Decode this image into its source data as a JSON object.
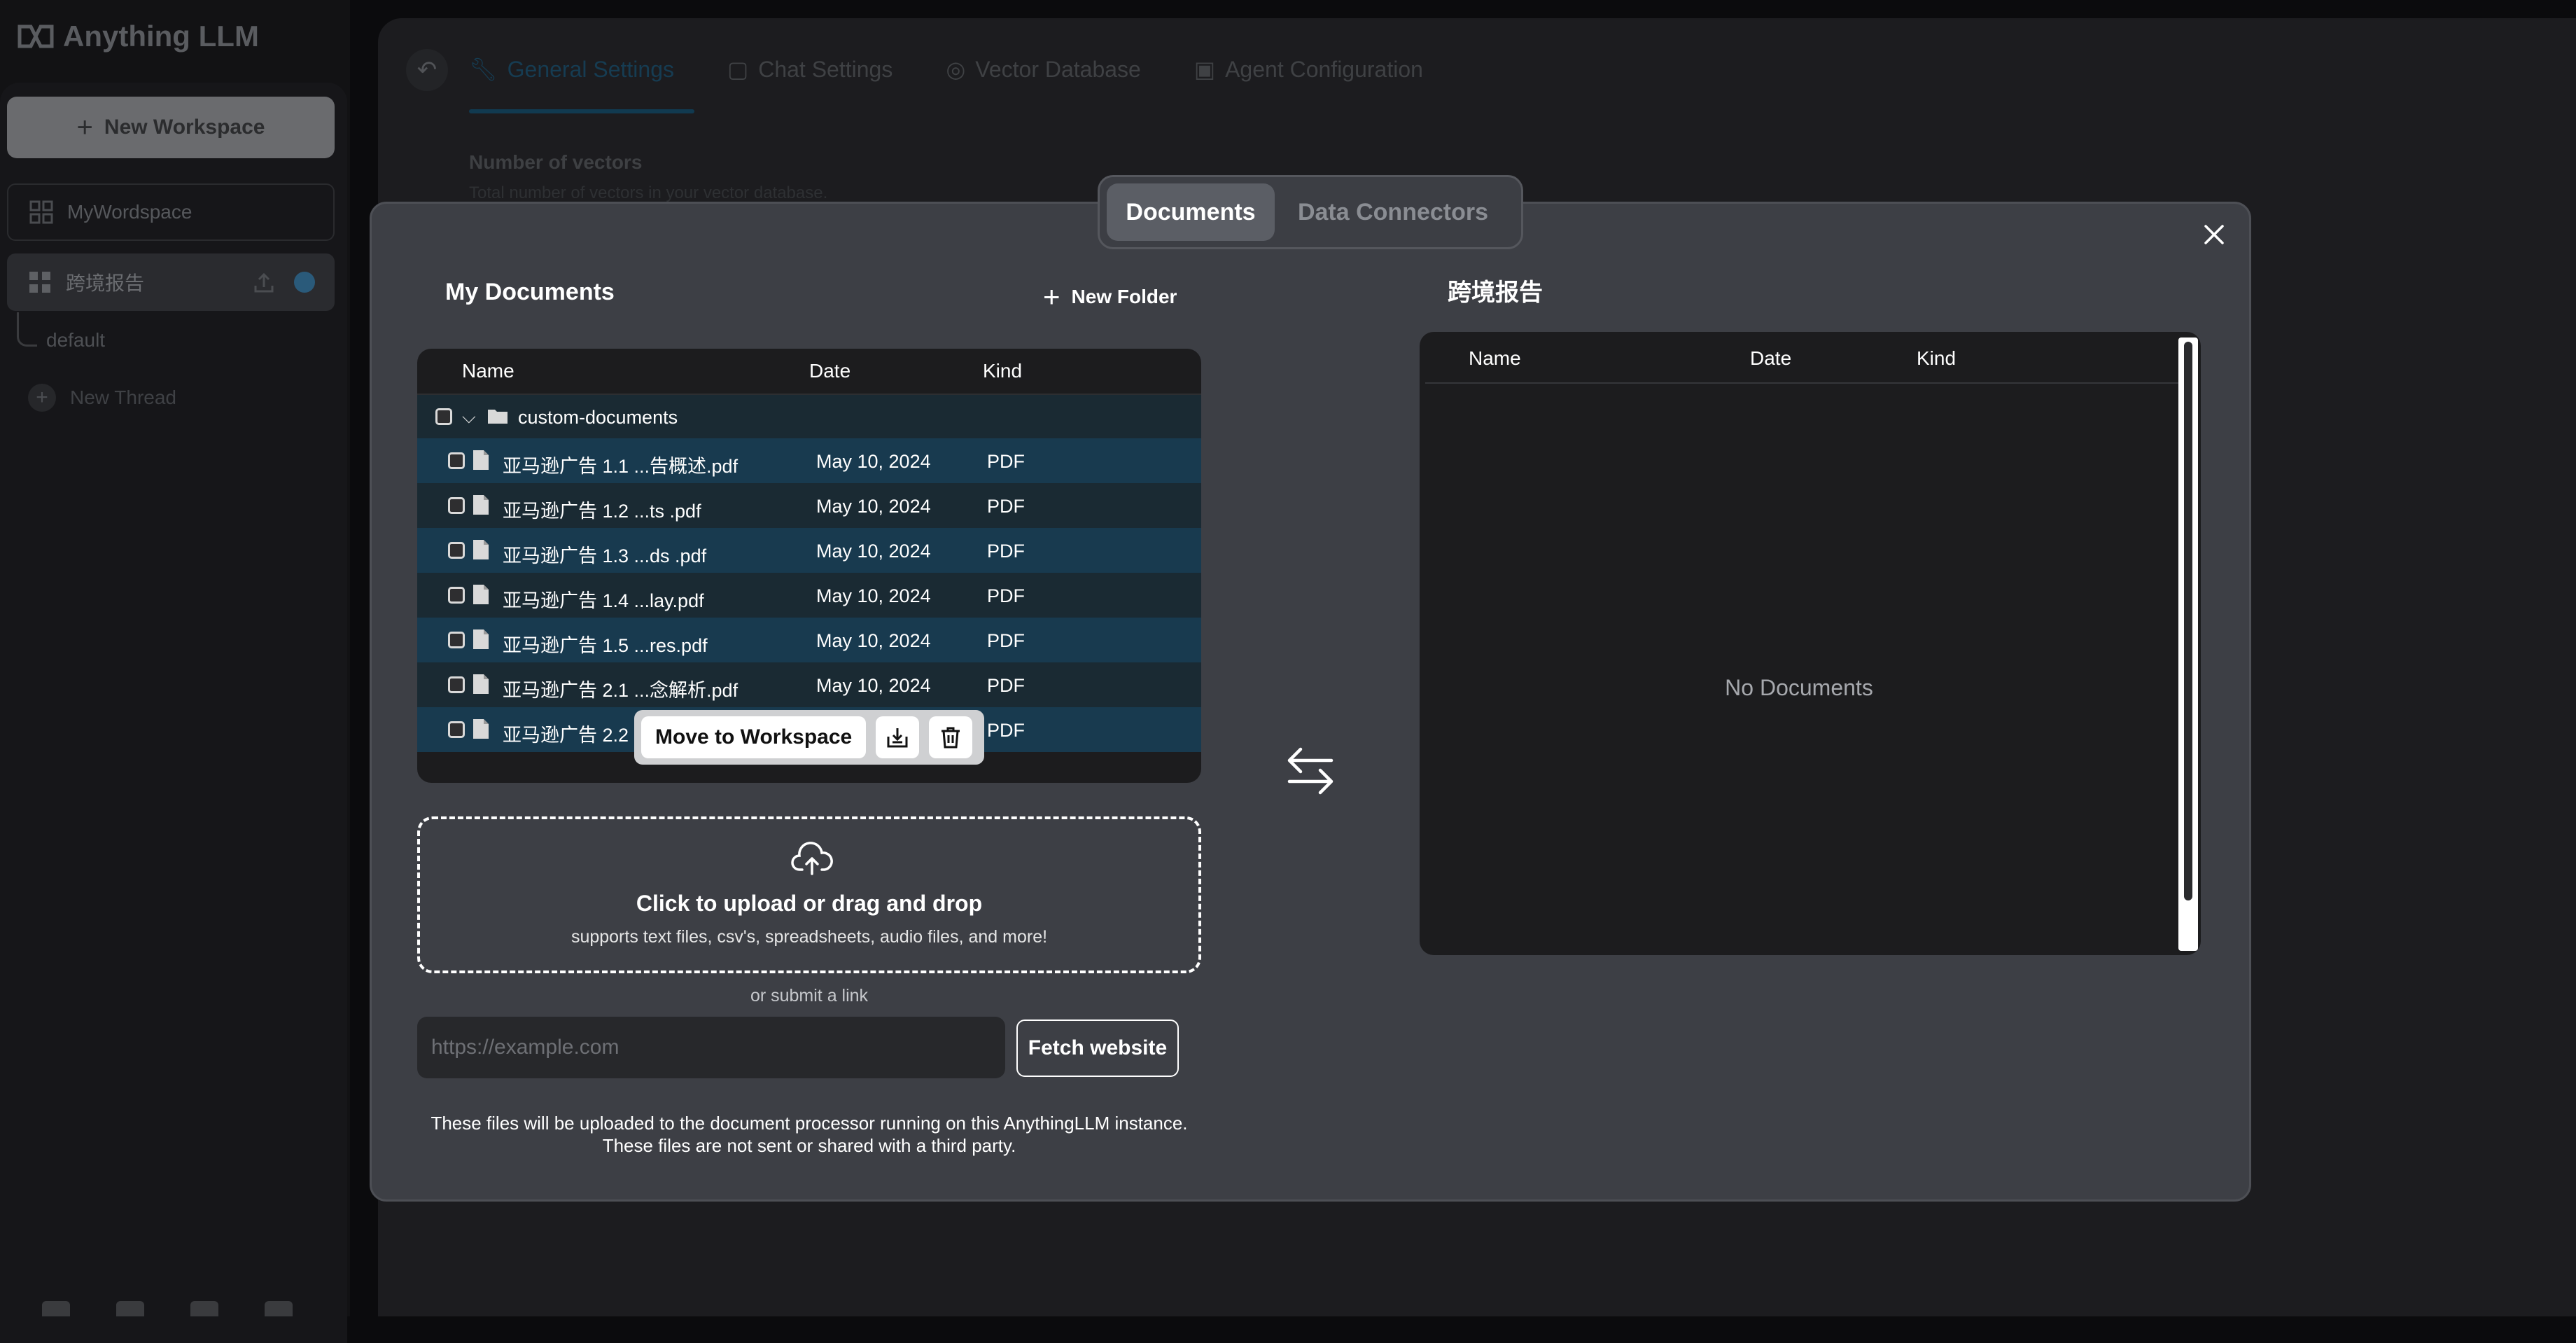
{
  "app": {
    "brand": "Anything LLM"
  },
  "sidebar": {
    "new_workspace_label": "New Workspace",
    "workspaces": [
      {
        "label": "MyWordspace"
      },
      {
        "label": "跨境报告"
      }
    ],
    "thread_default": "default",
    "new_thread_label": "New Thread"
  },
  "settings": {
    "tabs": [
      {
        "label": "General Settings",
        "icon": "wrench-icon"
      },
      {
        "label": "Chat Settings",
        "icon": "chat-icon"
      },
      {
        "label": "Vector Database",
        "icon": "database-icon"
      },
      {
        "label": "Agent Configuration",
        "icon": "robot-icon"
      }
    ],
    "vectors_label": "Number of vectors",
    "vectors_desc": "Total number of vectors in your vector database."
  },
  "modal": {
    "tabs": {
      "documents": "Documents",
      "data_connectors": "Data Connectors"
    },
    "my_documents": {
      "title": "My Documents",
      "new_folder": "New Folder",
      "columns": {
        "name": "Name",
        "date": "Date",
        "kind": "Kind"
      },
      "folder": "custom-documents",
      "files": [
        {
          "name": "亚马逊广告 1.1 ...告概述.pdf",
          "date": "May 10, 2024",
          "kind": "PDF"
        },
        {
          "name": "亚马逊广告 1.2 ...ts .pdf",
          "date": "May 10, 2024",
          "kind": "PDF"
        },
        {
          "name": "亚马逊广告 1.3 ...ds .pdf",
          "date": "May 10, 2024",
          "kind": "PDF"
        },
        {
          "name": "亚马逊广告 1.4 ...lay.pdf",
          "date": "May 10, 2024",
          "kind": "PDF"
        },
        {
          "name": "亚马逊广告 1.5 ...res.pdf",
          "date": "May 10, 2024",
          "kind": "PDF"
        },
        {
          "name": "亚马逊广告 2.1 ...念解析.pdf",
          "date": "May 10, 2024",
          "kind": "PDF"
        },
        {
          "name": "亚马逊广告 2.2 ...作",
          "date": "",
          "kind": "PDF"
        }
      ],
      "move_to_workspace": "Move to Workspace"
    },
    "upload": {
      "title": "Click to upload or drag and drop",
      "subtitle": "supports text files, csv's, spreadsheets, audio files, and more!",
      "or_link": "or submit a link",
      "url_placeholder": "https://example.com",
      "fetch_label": "Fetch website",
      "footnote_1": "These files will be uploaded to the document processor running on this AnythingLLM instance.",
      "footnote_2": "These files are not sent or shared with a third party."
    },
    "workspace_panel": {
      "title": "跨境报告",
      "columns": {
        "name": "Name",
        "date": "Date",
        "kind": "Kind"
      },
      "empty": "No Documents"
    }
  },
  "colors": {
    "accent": "#183a4f",
    "modal_bg": "#3d3f45",
    "table_bg": "#1c1c1e"
  }
}
